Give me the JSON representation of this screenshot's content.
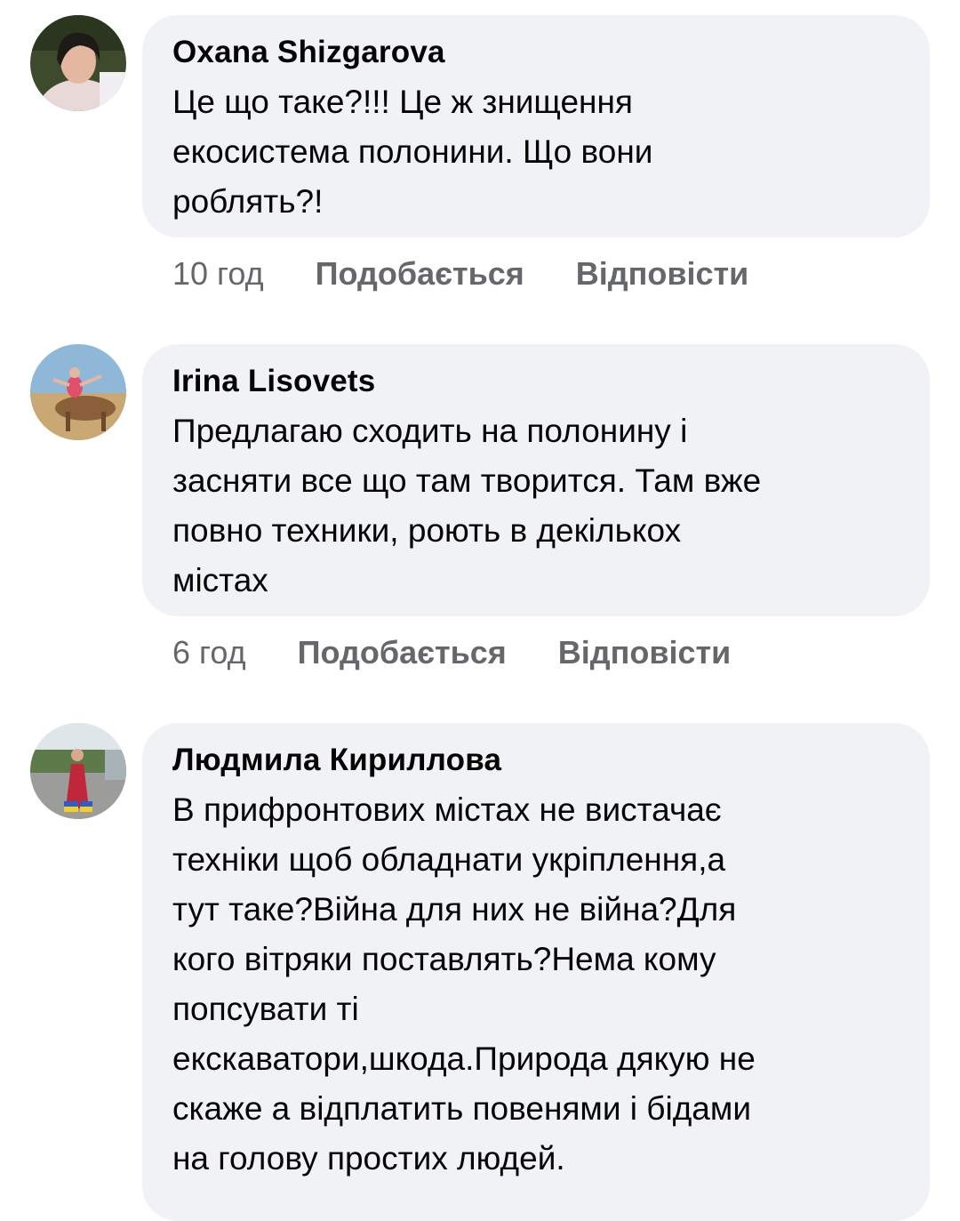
{
  "comments": [
    {
      "author": "Oxana  Shizgarova",
      "text": "Це що таке?!!! Це ж знищення\nекосистема  полонини. Що вони\nроблять?!",
      "time": "10 год",
      "like_label": "Подобається",
      "reply_label": "Відповісти"
    },
    {
      "author": "Irina Lisovets",
      "text": "Предлагаю сходить на полонину  і\nзасняти все що там творится. Там вже\nповно техники,  роють  в декількох\nмістах",
      "time": "6 год",
      "like_label": "Подобається",
      "reply_label": "Відповісти"
    },
    {
      "author": "Людмила Кириллова",
      "text": "В прифронтових містах не вистачає\nтехніки щоб обладнати укріплення,а\nтут таке?Війна для них не війна?Для\nкого вітряки поставлять?Нема кому\nпопсувати ті\nекскаватори,шкода.Природа дякую не\nскаже а відплатить повенями і бідами\nна голову простих людей."
    }
  ],
  "colors": {
    "bubble": "#f0f2f5",
    "text": "#050505",
    "meta": "#65676b"
  }
}
